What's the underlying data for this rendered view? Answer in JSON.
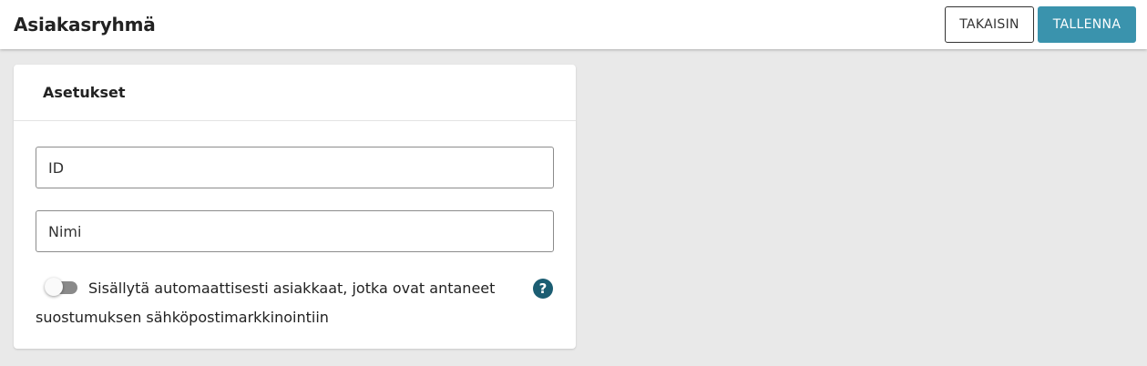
{
  "header": {
    "title": "Asiakasryhmä",
    "back_label": "TAKAISIN",
    "save_label": "TALLENNA"
  },
  "settings": {
    "title": "Asetukset",
    "id_field": {
      "placeholder": "ID",
      "value": ""
    },
    "name_field": {
      "placeholder": "Nimi",
      "value": ""
    },
    "auto_include": {
      "label": "Sisällytä automaattisesti asiakkaat, jotka ovat antaneet suostumuksen sähköpostimarkkinointiin",
      "enabled": false,
      "help_glyph": "?"
    }
  },
  "colors": {
    "primary": "#3a93ad",
    "help_icon": "#1b5d72",
    "background": "#e9e9e9"
  },
  "icons": [
    "help-circle-icon"
  ]
}
